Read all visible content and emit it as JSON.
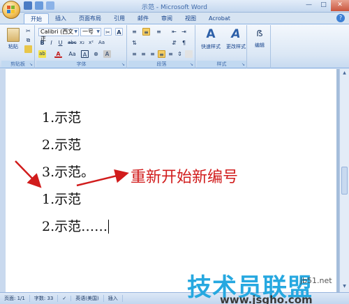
{
  "window": {
    "title": "示范 - Microsoft Word"
  },
  "tabs": [
    {
      "label": "开始",
      "active": true
    },
    {
      "label": "插入"
    },
    {
      "label": "页面布局"
    },
    {
      "label": "引用"
    },
    {
      "label": "邮件"
    },
    {
      "label": "审阅"
    },
    {
      "label": "视图"
    },
    {
      "label": "Acrobat"
    }
  ],
  "ribbon": {
    "clipboard": {
      "paste_label": "粘贴",
      "group_label": "剪贴板"
    },
    "font": {
      "font_name": "Calibri (西文正",
      "font_size": "一号",
      "group_label": "字体"
    },
    "paragraph": {
      "group_label": "段落"
    },
    "styles": {
      "quick_styles_label": "快速样式",
      "change_styles_label": "更改样式",
      "group_label": "样式"
    },
    "editing": {
      "label": "编辑"
    }
  },
  "document": {
    "lines": [
      "1.示范",
      "2.示范",
      "3.示范。",
      "1.示范",
      "2.示范……"
    ],
    "annotation": "重新开始新编号"
  },
  "statusbar": {
    "page": "页面: 1/1",
    "words": "字数: 33",
    "language": "英语(美国)",
    "mode": "插入"
  },
  "watermark": {
    "brand": "技术员联盟",
    "url": "www.jsgho.com",
    "small": "jb51.net"
  },
  "colors": {
    "accent": "#d11c1c",
    "ribbon": "#dbe7f5",
    "watermark": "#26a8e0"
  }
}
